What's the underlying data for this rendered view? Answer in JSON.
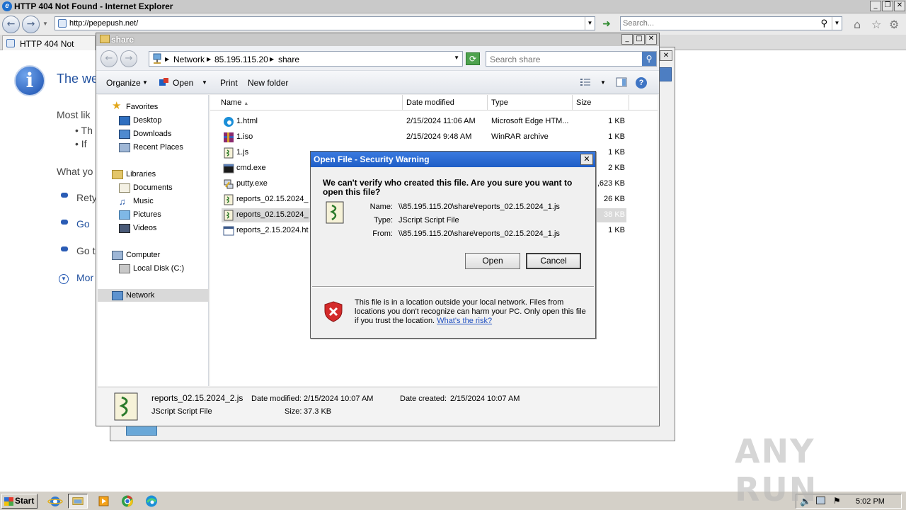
{
  "ie": {
    "window_title": "HTTP 404 Not Found - Internet Explorer",
    "address": "http://pepepush.net/",
    "search_placeholder": "Search...",
    "tab_title": "HTTP 404 Not Found",
    "error": {
      "title": "The we",
      "most_likely": "Most lik",
      "bullet1": "• Th",
      "bullet2": "• If",
      "what_you": "What yo",
      "link_retry": "Rety",
      "link_go1": "Go",
      "link_go2": "Go t",
      "link_more": "Mor"
    }
  },
  "explorer": {
    "title": "share",
    "breadcrumb": [
      "Network",
      "85.195.115.20",
      "share"
    ],
    "search_placeholder": "Search share",
    "toolbar": {
      "organize": "Organize",
      "open": "Open",
      "print": "Print",
      "new_folder": "New folder"
    },
    "nav": {
      "favorites": "Favorites",
      "desktop": "Desktop",
      "downloads": "Downloads",
      "recent_places": "Recent Places",
      "libraries": "Libraries",
      "documents": "Documents",
      "music": "Music",
      "pictures": "Pictures",
      "videos": "Videos",
      "computer": "Computer",
      "local_disk": "Local Disk (C:)",
      "network": "Network"
    },
    "columns": {
      "name": "Name",
      "date": "Date modified",
      "type": "Type",
      "size": "Size"
    },
    "files": [
      {
        "name": "1.html",
        "date": "2/15/2024 11:06 AM",
        "type": "Microsoft Edge HTM...",
        "size": "1 KB"
      },
      {
        "name": "1.iso",
        "date": "2/15/2024 9:48 AM",
        "type": "WinRAR archive",
        "size": "1 KB"
      },
      {
        "name": "1.js",
        "date": "",
        "type": "",
        "size": "1 KB"
      },
      {
        "name": "cmd.exe",
        "date": "",
        "type": "",
        "size": "2 KB"
      },
      {
        "name": "putty.exe",
        "date": "",
        "type": "",
        "size": ",623 KB"
      },
      {
        "name": "reports_02.15.2024_",
        "date": "",
        "type": "",
        "size": "26 KB"
      },
      {
        "name": "reports_02.15.2024_",
        "date": "",
        "type": "",
        "size": "38 KB"
      },
      {
        "name": "reports_2.15.2024.ht",
        "date": "",
        "type": "",
        "size": "1 KB"
      }
    ],
    "details": {
      "filename": "reports_02.15.2024_2.js",
      "date_modified_label": "Date modified:",
      "date_modified": "2/15/2024 10:07 AM",
      "date_created_label": "Date created:",
      "date_created": "2/15/2024 10:07 AM",
      "file_type": "JScript Script File",
      "size_label": "Size:",
      "size": "37.3 KB"
    }
  },
  "dialog": {
    "title": "Open File - Security Warning",
    "question": "We can't verify who created this file. Are you sure you want to open this file?",
    "name_label": "Name:",
    "name_value": "\\\\85.195.115.20\\share\\reports_02.15.2024_1.js",
    "type_label": "Type:",
    "type_value": "JScript Script File",
    "from_label": "From:",
    "from_value": "\\\\85.195.115.20\\share\\reports_02.15.2024_1.js",
    "open_label": "Open",
    "cancel_label": "Cancel",
    "warning_text": "This file is in a location outside your local network. Files from locations you don't recognize can harm your PC. Only open this file if you trust the location.",
    "risk_link": "What's the risk?"
  },
  "taskbar": {
    "start_label": "Start",
    "clock": "5:02 PM"
  },
  "watermark": "ANY RUN"
}
